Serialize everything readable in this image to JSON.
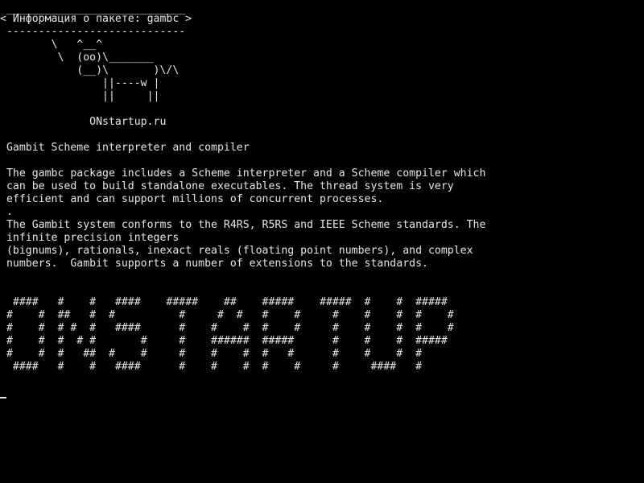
{
  "terminal": {
    "bubble": {
      "top_rule": " ____________________________",
      "title": "< Информация о пакете: gambc >",
      "bottom_rule": " ----------------------------"
    },
    "cow": [
      "        \\   ^__^",
      "         \\  (oo)\\_______",
      "            (__)\\       )\\/\\",
      "                ||----w |",
      "                ||     ||"
    ],
    "site": "              ONstartup.ru",
    "summary": " Gambit Scheme interpreter and compiler",
    "description": [
      " The gambc package includes a Scheme interpreter and a Scheme compiler which",
      " can be used to build standalone executables. The thread system is very",
      " efficient and can support millions of concurrent processes.",
      " .",
      " The Gambit system conforms to the R4RS, R5RS and IEEE Scheme standards. The",
      " infinite precision integers",
      " (bignums), rationals, inexact reals (floating point numbers), and complex",
      " numbers.  Gambit supports a number of extensions to the standards."
    ],
    "banner": [
      "  ####   #    #   ####    #####    ##    #####    #####  #    #  #####",
      " #    #  ##   #  #          #     #  #   #    #     #    #    #  #    #",
      " #    #  # #  #   ####      #    #    #  #    #     #    #    #  #    #",
      " #    #  #  # #       #     #    ######  #####      #    #    #  #####",
      " #    #  #   ##  #    #     #    #    #  #   #      #    #    #  #",
      "  ####   #    #   ####      #    #    #  #    #     #     ####   #"
    ]
  }
}
